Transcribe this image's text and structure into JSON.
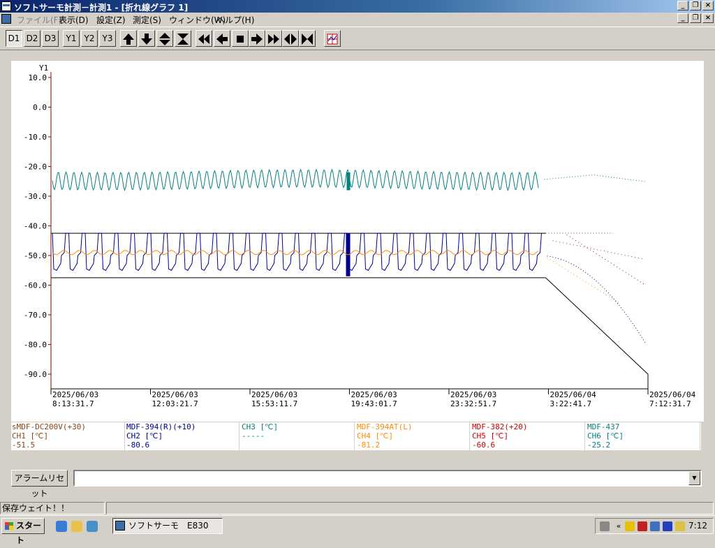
{
  "window": {
    "title": "ソフトサーモ計測－計測1 - [折れ線グラフ 1]"
  },
  "menu": [
    "ファイル(F)",
    "表示(D)",
    "設定(Z)",
    "測定(S)",
    "ウィンドウ(W)",
    "ヘルプ(H)"
  ],
  "toolbar": {
    "d_buttons": [
      "D1",
      "D2",
      "D3"
    ],
    "y_buttons": [
      "Y1",
      "Y2",
      "Y3"
    ],
    "selected": "D1"
  },
  "chart_data": {
    "type": "line",
    "y_axis_label": "Y1",
    "ylim": [
      -95,
      10
    ],
    "y_ticks": [
      "10.0",
      "0.0",
      "-10.0",
      "-20.0",
      "-30.0",
      "-40.0",
      "-50.0",
      "-60.0",
      "-70.0",
      "-80.0",
      "-90.0"
    ],
    "x_ticks": [
      {
        "date": "2025/06/03",
        "time": "8:13:31.7"
      },
      {
        "date": "2025/06/03",
        "time": "12:03:21.7"
      },
      {
        "date": "2025/06/03",
        "time": "15:53:11.7"
      },
      {
        "date": "2025/06/03",
        "time": "19:43:01.7"
      },
      {
        "date": "2025/06/03",
        "time": "23:32:51.7"
      },
      {
        "date": "2025/06/04",
        "time": "3:22:41.7"
      },
      {
        "date": "2025/06/04",
        "time": "7:12:31.7"
      }
    ],
    "series": [
      {
        "channel": "CH1",
        "name": "sMDF-DC200V(+30)",
        "color": "#8b4513"
      },
      {
        "channel": "CH2",
        "name": "MDF-394(R)(+10)",
        "color": "#00008b",
        "cycle_min": -55,
        "cycle_max": -43
      },
      {
        "channel": "CH3",
        "name": "",
        "color": "#008080"
      },
      {
        "channel": "CH4",
        "name": "MDF-394AT(L)",
        "color": "#ff8c00",
        "mean": -49
      },
      {
        "channel": "CH5",
        "name": "MDF-382(+20)",
        "color": "#cc0000"
      },
      {
        "channel": "CH6",
        "name": "MDF-437",
        "color": "#008080",
        "min": -27.5,
        "max": -21.5
      }
    ],
    "envelope_upper": -42.5,
    "envelope_lower_level": -57.5,
    "envelope_lower_end": -90,
    "grid": false
  },
  "legend": [
    {
      "name": "sMDF-DC200V(+30)",
      "channel": "CH1 [℃]",
      "value": "-51.5",
      "color": "#8b4513"
    },
    {
      "name": "MDF-394(R)(+10)",
      "channel": "CH2 [℃]",
      "value": "-80.6",
      "color": "#00008b"
    },
    {
      "name": "",
      "channel": "CH3 [℃]",
      "value": "-----",
      "color": "#008080"
    },
    {
      "name": "MDF-394AT(L)",
      "channel": "CH4 [℃]",
      "value": "-81.2",
      "color": "#ff8c00"
    },
    {
      "name": "MDF-382(+20)",
      "channel": "CH5 [℃]",
      "value": "-60.6",
      "color": "#cc0000"
    },
    {
      "name": "MDF-437",
      "channel": "CH6 [℃]",
      "value": "-25.2",
      "color": "#008080"
    }
  ],
  "alarm": {
    "reset_label": "アラームリセット",
    "value": ""
  },
  "status": {
    "text": "保存ウェイト！！"
  },
  "taskbar": {
    "start_label": "スタート",
    "task_label": "ソフトサーモ　E830",
    "clock": "7:12"
  },
  "icons": {
    "start": "windows-flag-icon",
    "ie": "internet-explorer-icon",
    "folder": "folder-icon",
    "media": "media-icon"
  }
}
